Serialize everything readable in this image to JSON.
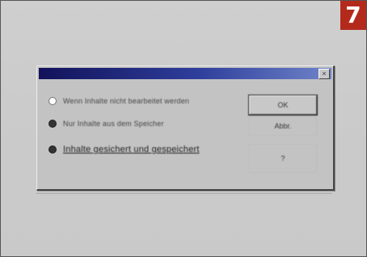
{
  "step": {
    "number": "7"
  },
  "dialog": {
    "title": "",
    "close_symbol": "×",
    "options": [
      {
        "label": "Wenn Inhalte nicht bearbeitet werden",
        "selected": false
      },
      {
        "label": "Nur Inhalte aus dem Speicher",
        "selected": true
      },
      {
        "label": "Inhalte gesichert und gespeichert",
        "selected": true
      }
    ],
    "buttons": {
      "ok": "OK",
      "cancel": "Abbr.",
      "help": "?"
    }
  },
  "colors": {
    "badge": "#b32a1c",
    "titlebar": "#12125a"
  }
}
